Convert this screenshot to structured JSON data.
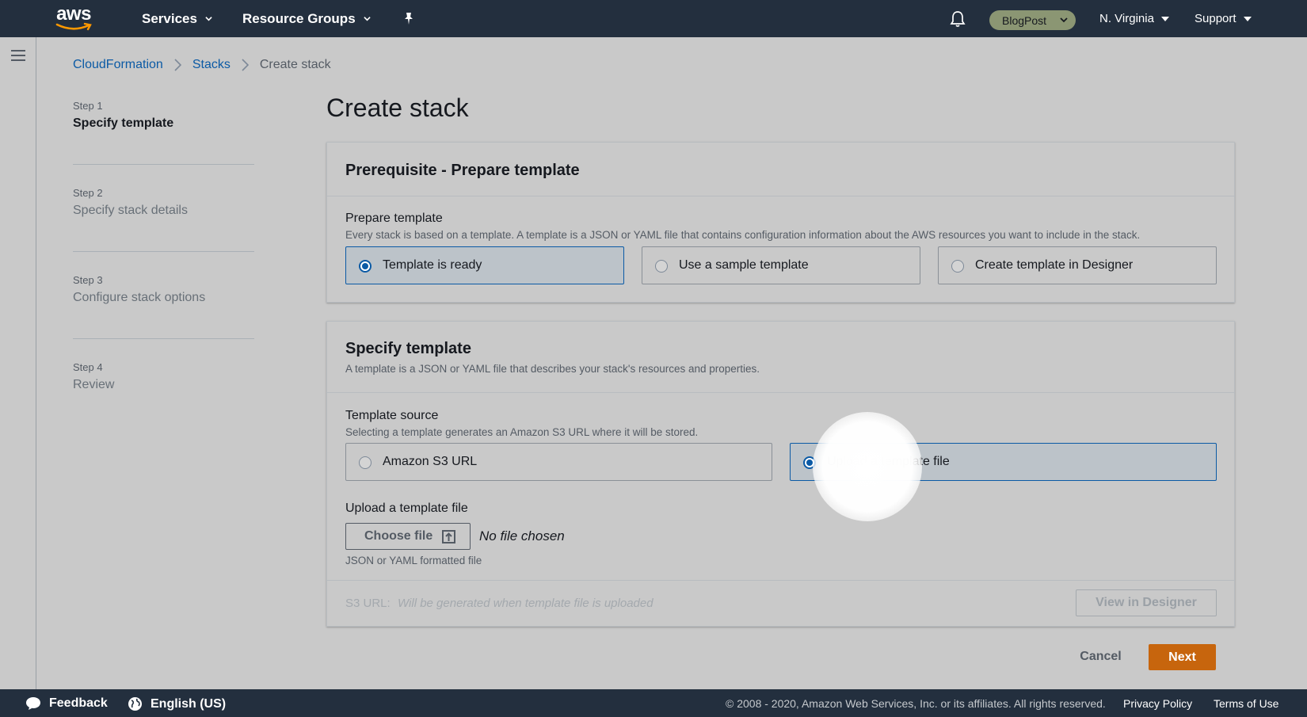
{
  "topnav": {
    "logo": "aws",
    "services": "Services",
    "resource_groups": "Resource Groups",
    "pin_icon": "pushpin-icon",
    "bell_icon": "bell-icon",
    "account": "BlogPost",
    "region": "N. Virginia",
    "support": "Support"
  },
  "breadcrumb": {
    "items": [
      "CloudFormation",
      "Stacks",
      "Create stack"
    ]
  },
  "steps": [
    {
      "num": "Step 1",
      "title": "Specify template",
      "active": true
    },
    {
      "num": "Step 2",
      "title": "Specify stack details"
    },
    {
      "num": "Step 3",
      "title": "Configure stack options"
    },
    {
      "num": "Step 4",
      "title": "Review"
    }
  ],
  "page_title": "Create stack",
  "prereq": {
    "heading": "Prerequisite - Prepare template",
    "label": "Prepare template",
    "description": "Every stack is based on a template. A template is a JSON or YAML file that contains configuration information about the AWS resources you want to include in the stack.",
    "options": [
      "Template is ready",
      "Use a sample template",
      "Create template in Designer"
    ],
    "selected": "Template is ready"
  },
  "specify": {
    "heading": "Specify template",
    "subheading": "A template is a JSON or YAML file that describes your stack's resources and properties.",
    "source_label": "Template source",
    "source_desc": "Selecting a template generates an Amazon S3 URL where it will be stored.",
    "options": [
      "Amazon S3 URL",
      "Upload a template file"
    ],
    "selected": "Upload a template file",
    "upload_label": "Upload a template file",
    "choose_file": "Choose file",
    "no_file": "No file chosen",
    "upload_hint": "JSON or YAML formatted file",
    "s3_url_label": "S3 URL:",
    "s3_url_placeholder": "Will be generated when template file is uploaded",
    "view_in_designer": "View in Designer"
  },
  "actions": {
    "cancel": "Cancel",
    "next": "Next"
  },
  "bottombar": {
    "feedback": "Feedback",
    "language": "English (US)",
    "copyright": "© 2008 - 2020, Amazon Web Services, Inc. or its affiliates. All rights reserved.",
    "privacy": "Privacy Policy",
    "terms": "Terms of Use"
  },
  "colors": {
    "nav_bg": "#232f3e",
    "link": "#0b5aa5",
    "primary_button": "#c7650d",
    "account_pill": "#8b9673"
  }
}
